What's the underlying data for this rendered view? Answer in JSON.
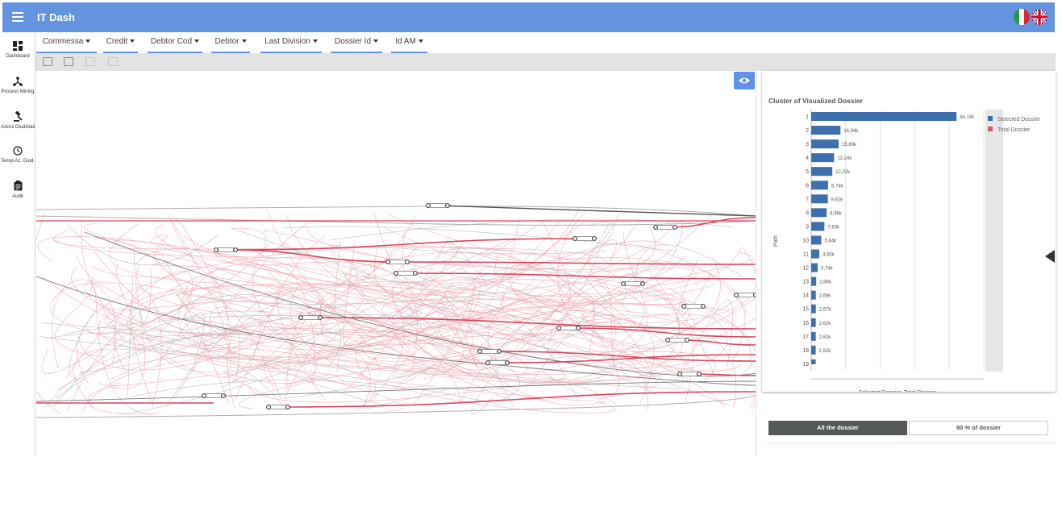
{
  "app": {
    "title": "IT Dash"
  },
  "colors": {
    "header": "#6494e0",
    "selected": "#3e70ad",
    "total": "#cf5b6c",
    "accent_button": "#5e92e8"
  },
  "languages": [
    "italian-flag-icon",
    "uk-flag-icon"
  ],
  "sidebar": {
    "items": [
      {
        "label": "Dashboard",
        "icon": "dashboard-icon"
      },
      {
        "label": "Process Mining",
        "icon": "process-mining-icon"
      },
      {
        "label": "Azioni Giudiziali",
        "icon": "gavel-icon"
      },
      {
        "label": "Tempi Az. Giud.",
        "icon": "clock-icon"
      },
      {
        "label": "Audit",
        "icon": "clipboard-icon"
      }
    ]
  },
  "filters": [
    {
      "label": "Commessa"
    },
    {
      "label": "Credit"
    },
    {
      "label": "Debtor Cod"
    },
    {
      "label": "Debtor"
    },
    {
      "label": "Last Division"
    },
    {
      "label": "Dossier Id"
    },
    {
      "label": "Id AM"
    }
  ],
  "toolbar": {
    "tools": [
      "zoom-select-icon",
      "fit-to-screen-icon",
      "export-icon",
      "settings-icon"
    ]
  },
  "map": {
    "toggle_icon": "eye-icon"
  },
  "chart_data": {
    "type": "bar",
    "orientation": "horizontal",
    "title": "Cluster of Visualized Dossier",
    "xlabel": "Selected Dossier, Total Dossier",
    "ylabel": "Path",
    "categories": [
      "1",
      "2",
      "3",
      "4",
      "5",
      "6",
      "7",
      "8",
      "9",
      "10",
      "11",
      "12",
      "13",
      "14",
      "15",
      "16",
      "17",
      "18",
      "19"
    ],
    "series": [
      {
        "name": "Selected Dossier",
        "color": "#3e70ad",
        "values": [
          84190,
          16940,
          15890,
          13240,
          12220,
          9740,
          9620,
          8960,
          7630,
          5840,
          4650,
          3740,
          2880,
          2680,
          2670,
          2620,
          2620,
          2620,
          2600
        ]
      },
      {
        "name": "Total Dossier",
        "color": "#cf5b6c",
        "values": []
      }
    ],
    "data_labels": [
      "84,19k",
      "16,94k",
      "15,89k",
      "13,24k",
      "12,22k",
      "9,74k",
      "9,62k",
      "8,96k",
      "7,63k",
      "5,84k",
      "4,65k",
      "3,74k",
      "2,88k",
      "2,68k",
      "2,67k",
      "2,62k",
      "2,62k",
      "2,62k",
      ""
    ],
    "xlim": [
      0,
      100000
    ],
    "grid": true,
    "legend": "top-right"
  },
  "buttons": {
    "all_label": "All the dossier",
    "eighty_label": "80 % of dossier"
  }
}
